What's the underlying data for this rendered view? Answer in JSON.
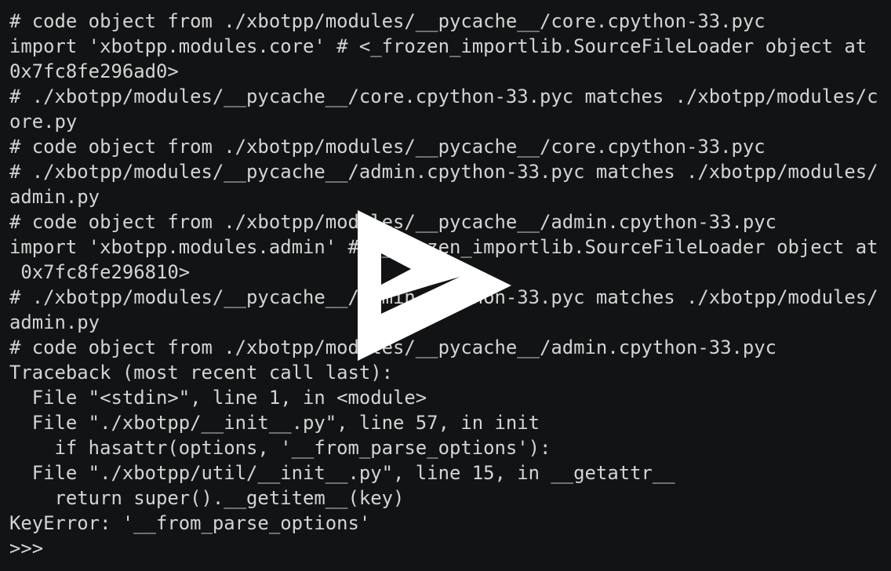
{
  "terminal": {
    "lines": [
      "# code object from ./xbotpp/modules/__pycache__/core.cpython-33.pyc",
      "import 'xbotpp.modules.core' # <_frozen_importlib.SourceFileLoader object at",
      "0x7fc8fe296ad0>",
      "# ./xbotpp/modules/__pycache__/core.cpython-33.pyc matches ./xbotpp/modules/c",
      "ore.py",
      "# code object from ./xbotpp/modules/__pycache__/core.cpython-33.pyc",
      "# ./xbotpp/modules/__pycache__/admin.cpython-33.pyc matches ./xbotpp/modules/",
      "admin.py",
      "# code object from ./xbotpp/modules/__pycache__/admin.cpython-33.pyc",
      "import 'xbotpp.modules.admin' # <_frozen_importlib.SourceFileLoader object at",
      " 0x7fc8fe296810>",
      "# ./xbotpp/modules/__pycache__/admin.cpython-33.pyc matches ./xbotpp/modules/",
      "admin.py",
      "# code object from ./xbotpp/modules/__pycache__/admin.cpython-33.pyc",
      "Traceback (most recent call last):",
      "  File \"<stdin>\", line 1, in <module>",
      "  File \"./xbotpp/__init__.py\", line 57, in init",
      "    if hasattr(options, '__from_parse_options'):",
      "  File \"./xbotpp/util/__init__.py\", line 15, in __getattr__",
      "    return super().__getitem__(key)",
      "KeyError: '__from_parse_options'",
      ">>>"
    ]
  },
  "overlay": {
    "icon": "play-icon",
    "color": "#ffffff"
  },
  "colors": {
    "background": "#121314",
    "text": "#d4d4d4"
  }
}
